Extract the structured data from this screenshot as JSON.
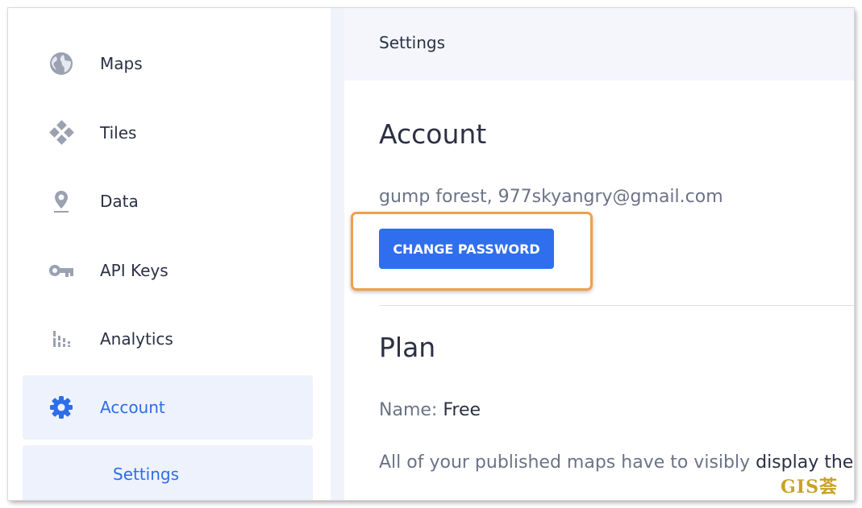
{
  "sidebar": {
    "items": [
      {
        "label": "Maps",
        "icon": "globe-icon"
      },
      {
        "label": "Tiles",
        "icon": "tiles-icon"
      },
      {
        "label": "Data",
        "icon": "map-pin-icon"
      },
      {
        "label": "API Keys",
        "icon": "key-icon"
      },
      {
        "label": "Analytics",
        "icon": "bar-chart-icon"
      },
      {
        "label": "Account",
        "icon": "gear-icon",
        "active": true
      }
    ],
    "sub_item": {
      "label": "Settings",
      "active": true
    }
  },
  "header": {
    "title": "Settings"
  },
  "account": {
    "heading": "Account",
    "user_line": "gump forest, 977skyangry@gmail.com",
    "change_password_label": "CHANGE PASSWORD"
  },
  "plan": {
    "heading": "Plan",
    "name_label": "Name:",
    "name_value": "Free",
    "desc_prefix": "All of your published maps have to visibly",
    "desc_bold": "display the"
  },
  "watermark": "GIS荟",
  "colors": {
    "accent": "#2f6fed",
    "active_bg": "#edf2fc",
    "highlight_border": "#f0a04b",
    "icon_gray": "#9aa1b1"
  }
}
